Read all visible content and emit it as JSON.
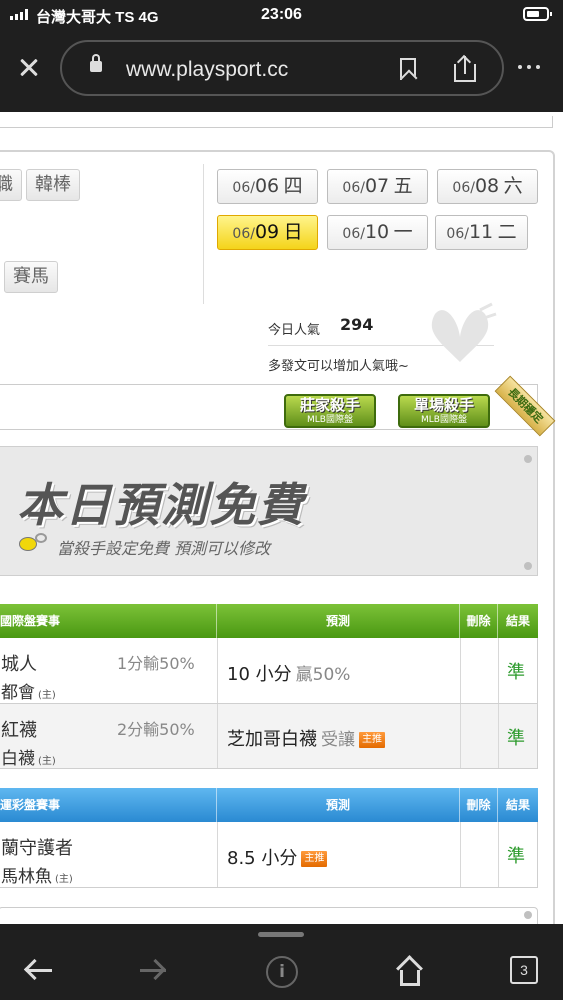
{
  "status_bar": {
    "carrier": "台灣大哥大 TS  4G",
    "time": "23:06"
  },
  "browser": {
    "url": "www.playsport.cc"
  },
  "sports_tabs": [
    {
      "label": "職"
    },
    {
      "label": "韓棒"
    },
    {
      "label": "賽馬"
    }
  ],
  "dates": [
    {
      "md": "06/",
      "dd": "06",
      "wd": "四"
    },
    {
      "md": "06/",
      "dd": "07",
      "wd": "五"
    },
    {
      "md": "06/",
      "dd": "08",
      "wd": "六"
    },
    {
      "md": "06/",
      "dd": "09",
      "wd": "日",
      "active": true
    },
    {
      "md": "06/",
      "dd": "10",
      "wd": "一"
    },
    {
      "md": "06/",
      "dd": "11",
      "wd": "二"
    }
  ],
  "popularity": {
    "label": "今日人氣",
    "value": "294",
    "note": "多發文可以增加人氣哦~"
  },
  "badges": [
    {
      "title": "莊家殺手",
      "sub": "MLB國際盤"
    },
    {
      "title": "單場殺手",
      "sub": "MLB國際盤"
    }
  ],
  "ribbon": "長期穩定",
  "free_banner": {
    "title": "本日預測免費",
    "subtitle": "當殺手設定免費  預測可以修改"
  },
  "intl_table": {
    "header": "國際盤賽事",
    "col_predict": "預測",
    "col_delete": "刪除",
    "col_result": "結果",
    "rows": [
      {
        "team1": "城人",
        "team2": "都會",
        "host": "(主)",
        "line": "1分輸50%",
        "prediction": "10 小分",
        "pred_sub": "贏50%",
        "main_tag": "",
        "result": "準"
      },
      {
        "team1": "紅襪",
        "team2": "白襪",
        "host": "(主)",
        "line": "2分輸50%",
        "prediction": "芝加哥白襪",
        "pred_sub": "受讓",
        "main_tag": "主推",
        "result": "準"
      }
    ]
  },
  "lottery_table": {
    "header": "運彩盤賽事",
    "col_predict": "預測",
    "col_delete": "刪除",
    "col_result": "結果",
    "rows": [
      {
        "team1": "蘭守護者",
        "team2": "馬林魚",
        "host": "(主)",
        "prediction": "8.5 小分",
        "main_tag": "主推",
        "result": "準"
      }
    ]
  },
  "toolbar": {
    "tab_count": "3"
  }
}
